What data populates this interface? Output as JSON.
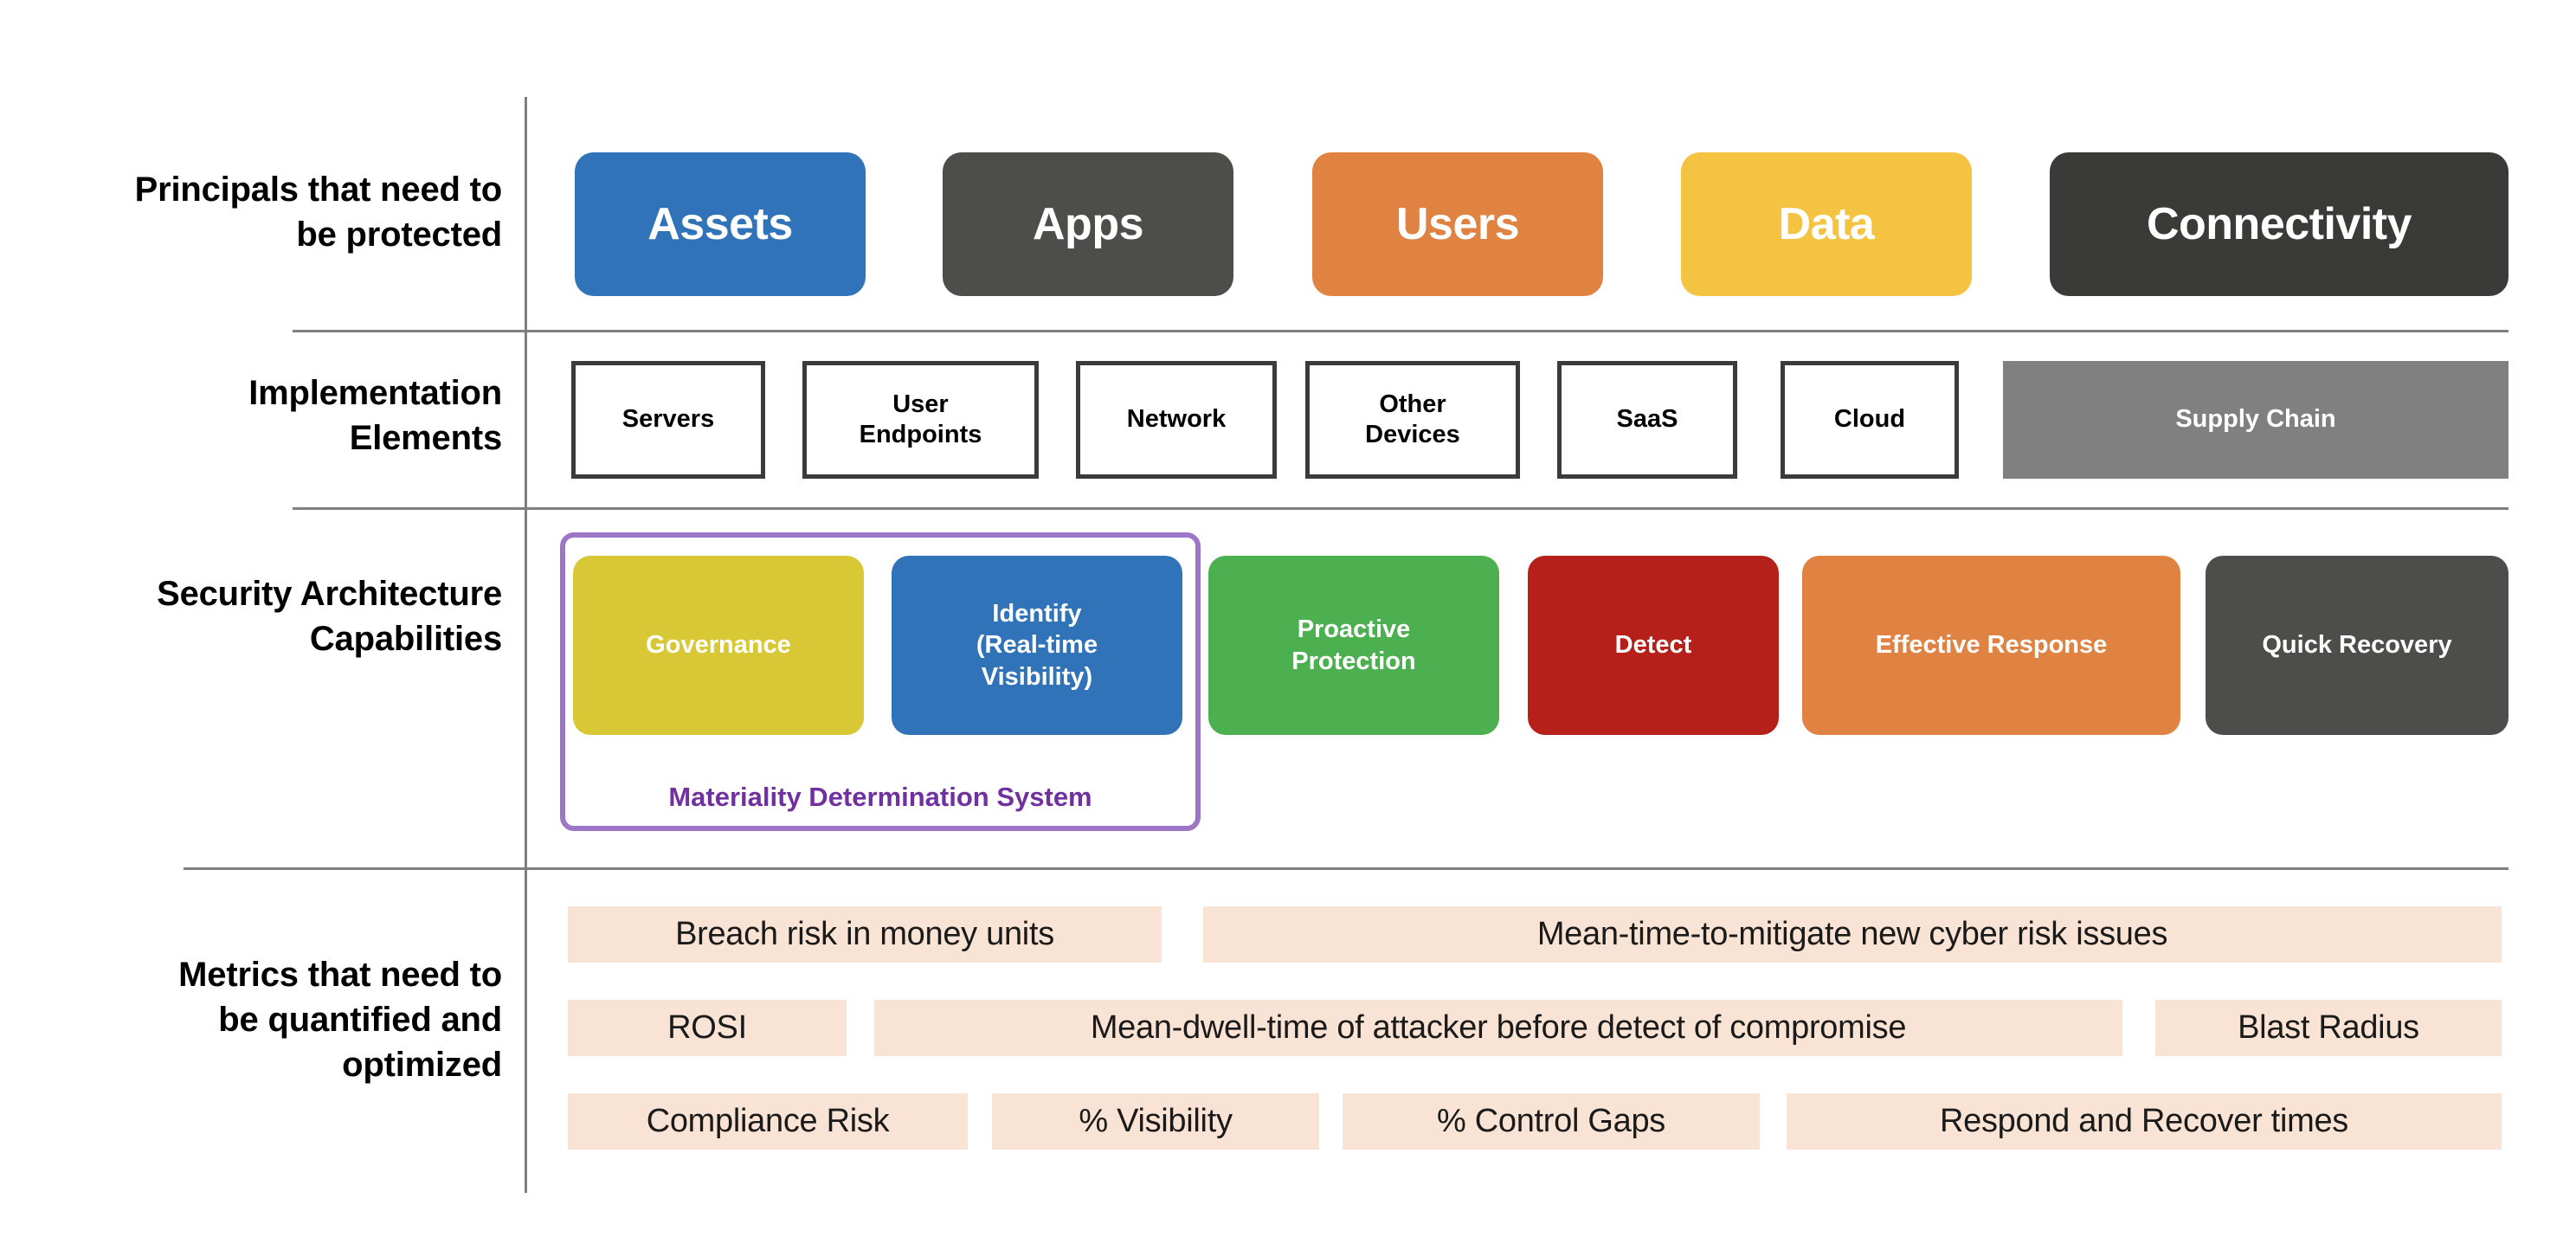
{
  "rows": [
    {
      "id": "principals",
      "label": "Principals that need to\nbe protected",
      "items": [
        {
          "label": "Assets",
          "color": "#3073b8"
        },
        {
          "label": "Apps",
          "color": "#4d4d4b"
        },
        {
          "label": "Users",
          "color": "#e08342"
        },
        {
          "label": "Data",
          "color": "#f5c342"
        },
        {
          "label": "Connectivity",
          "color": "#3a3a38"
        }
      ]
    },
    {
      "id": "implementation",
      "label": "Implementation\nElements",
      "items": [
        {
          "label": "Servers",
          "style": "outline"
        },
        {
          "label": "User\nEndpoints",
          "style": "outline"
        },
        {
          "label": "Network",
          "style": "outline"
        },
        {
          "label": "Other\nDevices",
          "style": "outline"
        },
        {
          "label": "SaaS",
          "style": "outline"
        },
        {
          "label": "Cloud",
          "style": "outline"
        },
        {
          "label": "Supply Chain",
          "style": "filled",
          "color": "#808080"
        }
      ]
    },
    {
      "id": "capabilities",
      "label": "Security Architecture\nCapabilities",
      "items": [
        {
          "label": "Governance",
          "color": "#d9c835"
        },
        {
          "label": "Identify\n(Real-time\nVisibility)",
          "color": "#3073b8"
        },
        {
          "label": "Proactive\nProtection",
          "color": "#4caf50"
        },
        {
          "label": "Detect",
          "color": "#b5201a"
        },
        {
          "label": "Effective Response",
          "color": "#e08342"
        },
        {
          "label": "Quick Recovery",
          "color": "#4d4d4b"
        }
      ],
      "group": {
        "caption": "Materiality Determination System",
        "border_color": "#9e76c8",
        "caption_color": "#7030a0",
        "members": [
          "Governance",
          "Identify (Real-time Visibility)"
        ]
      }
    },
    {
      "id": "metrics",
      "label": "Metrics that need to\nbe quantified and\noptimized",
      "pill_color": "#f9e3d4",
      "lines": [
        [
          {
            "label": "Breach risk in money units"
          },
          {
            "label": "Mean-time-to-mitigate new cyber risk issues"
          }
        ],
        [
          {
            "label": "ROSI"
          },
          {
            "label": "Mean-dwell-time of attacker before detect of compromise"
          },
          {
            "label": "Blast Radius"
          }
        ],
        [
          {
            "label": "Compliance Risk"
          },
          {
            "label": "% Visibility"
          },
          {
            "label": "% Control Gaps"
          },
          {
            "label": "Respond and Recover times"
          }
        ]
      ]
    }
  ],
  "colors": {
    "rule": "#7f7f7f",
    "outline_border": "#3b3b3b",
    "text_dark": "#000000",
    "text_light": "#ffffff",
    "background": "#ffffff"
  }
}
